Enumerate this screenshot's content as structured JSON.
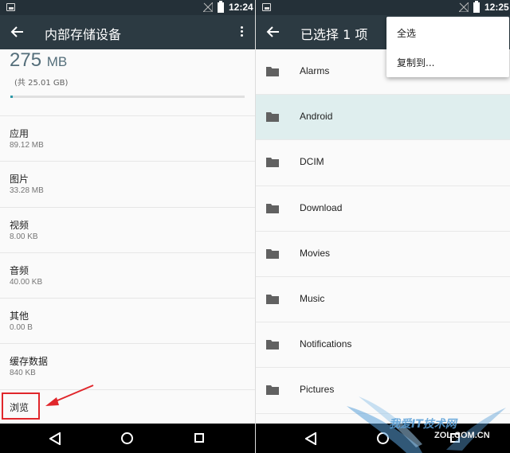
{
  "left": {
    "status": {
      "time": "12:24"
    },
    "toolbar": {
      "title": "内部存储设备"
    },
    "storage": {
      "used_value": "275",
      "used_unit": "MB",
      "total": "(共 25.01 GB)",
      "used_fraction": 0.011
    },
    "categories": [
      {
        "name": "应用",
        "size": "89.12 MB"
      },
      {
        "name": "图片",
        "size": "33.28 MB"
      },
      {
        "name": "视频",
        "size": "8.00 KB"
      },
      {
        "name": "音频",
        "size": "40.00 KB"
      },
      {
        "name": "其他",
        "size": "0.00 B"
      },
      {
        "name": "缓存数据",
        "size": "840 KB"
      }
    ],
    "browse_label": "浏览"
  },
  "right": {
    "status": {
      "time": "12:25"
    },
    "toolbar": {
      "title": "已选择 1 项"
    },
    "menu": {
      "select_all": "全选",
      "copy_to": "复制到..."
    },
    "folders": [
      {
        "name": "Alarms",
        "selected": false
      },
      {
        "name": "Android",
        "selected": true
      },
      {
        "name": "DCIM",
        "selected": false
      },
      {
        "name": "Download",
        "selected": false
      },
      {
        "name": "Movies",
        "selected": false
      },
      {
        "name": "Music",
        "selected": false
      },
      {
        "name": "Notifications",
        "selected": false
      },
      {
        "name": "Pictures",
        "selected": false
      }
    ]
  },
  "watermark": {
    "brand": "我爱IT技术网",
    "site": "ZOL.COM.CN"
  },
  "colors": {
    "toolbar": "#2c3a42",
    "statusbar": "#243038",
    "accent": "#2e98a8",
    "selected_row": "#dfeeee",
    "annotation": "#e0262b"
  }
}
